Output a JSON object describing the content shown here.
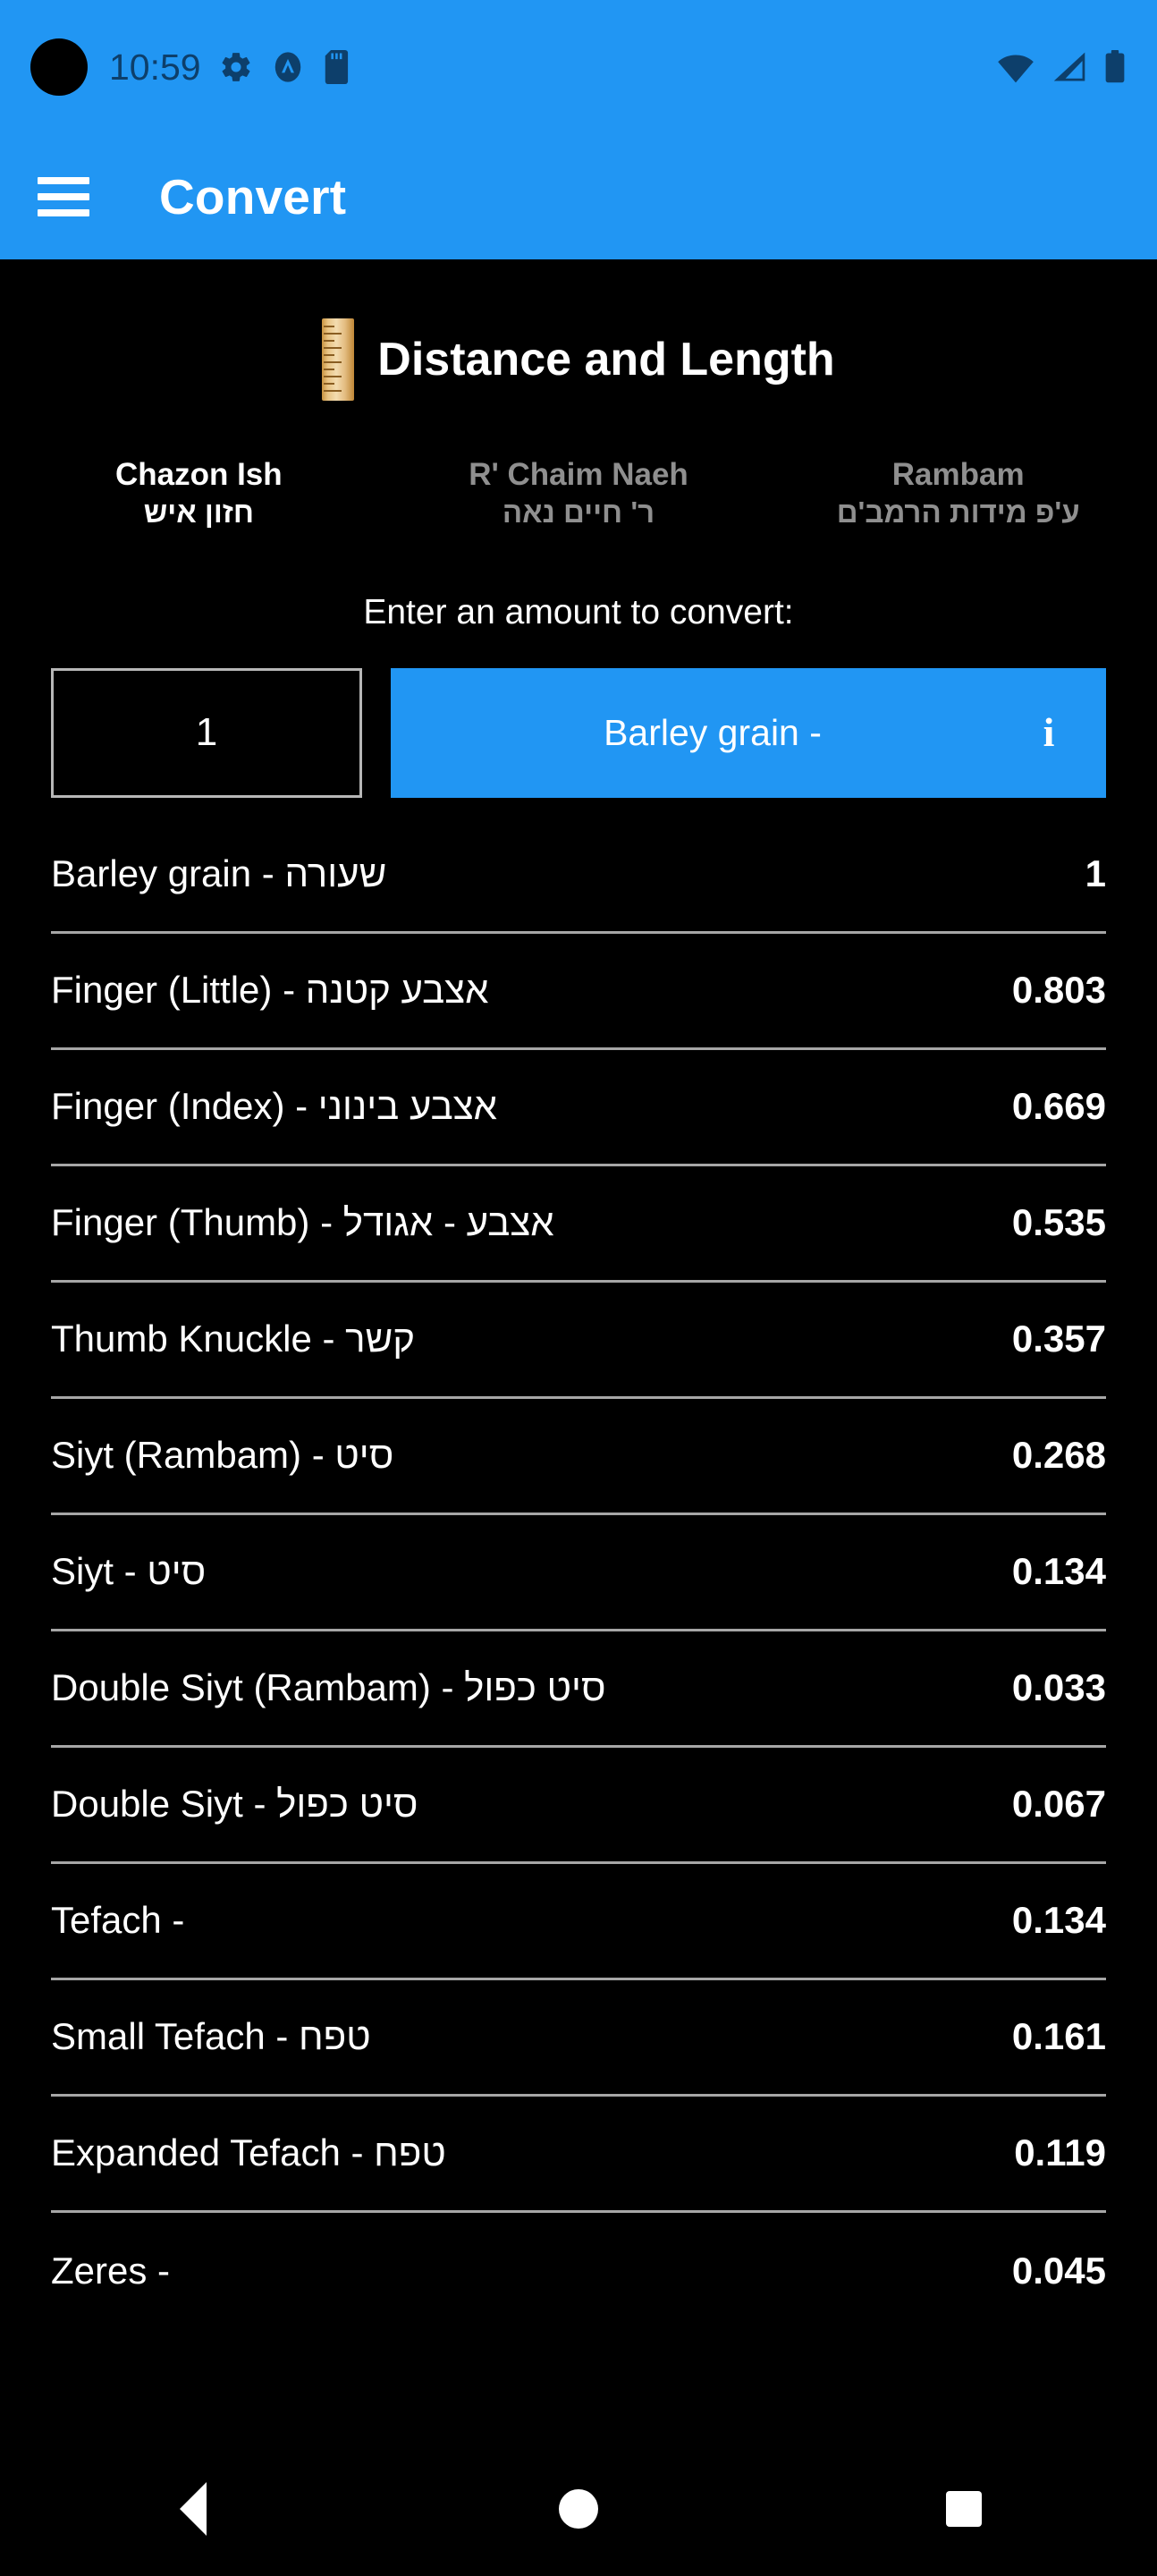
{
  "status_bar": {
    "time": "10:59",
    "icons_left": [
      "gear-icon",
      "shield-icon",
      "sd-card-icon"
    ],
    "icons_right": [
      "wifi-icon",
      "cell-signal-icon",
      "battery-icon"
    ],
    "background_color": "#2196f3",
    "icon_color": "#0d3f6b"
  },
  "app_bar": {
    "menu_icon": "hamburger-menu-icon",
    "title": "Convert",
    "background_color": "#2196f3"
  },
  "page": {
    "icon": "ruler-icon",
    "title": "Distance and Length"
  },
  "tabs": [
    {
      "en": "Chazon Ish",
      "he": "חזון איש",
      "active": true
    },
    {
      "en": "R' Chaim Naeh",
      "he": "ר' חיים נאה",
      "active": false
    },
    {
      "en": "Rambam",
      "he": "ע'פ מידות הרמב'ם",
      "active": false
    }
  ],
  "input": {
    "prompt": "Enter an amount to convert:",
    "amount_value": "1",
    "amount_placeholder": "1",
    "unit_label": "Barley grain -",
    "info_icon_glyph": "i",
    "accent_color": "#2196f3"
  },
  "results": [
    {
      "name": "Barley grain - שעורה",
      "value": "1"
    },
    {
      "name": "Finger (Little) - אצבע קטנה",
      "value": "0.803"
    },
    {
      "name": "Finger (Index) - אצבע בינוני",
      "value": "0.669"
    },
    {
      "name": "Finger (Thumb) - אצבע - אגודל",
      "value": "0.535"
    },
    {
      "name": "Thumb Knuckle - קשר",
      "value": "0.357"
    },
    {
      "name": "Siyt (Rambam) - סיט",
      "value": "0.268"
    },
    {
      "name": "Siyt - סיט",
      "value": "0.134"
    },
    {
      "name": "Double Siyt (Rambam) - סיט כפול",
      "value": "0.033"
    },
    {
      "name": "Double Siyt - סיט כפול",
      "value": "0.067"
    },
    {
      "name": "Tefach -",
      "value": "0.134"
    },
    {
      "name": "Small Tefach - טפח",
      "value": "0.161"
    },
    {
      "name": "Expanded Tefach - טפח",
      "value": "0.119"
    },
    {
      "name": "Zeres -",
      "value": "0.045"
    }
  ],
  "nav_bar": {
    "back": "back-nav-button",
    "home": "home-nav-button",
    "recents": "recents-nav-button"
  }
}
